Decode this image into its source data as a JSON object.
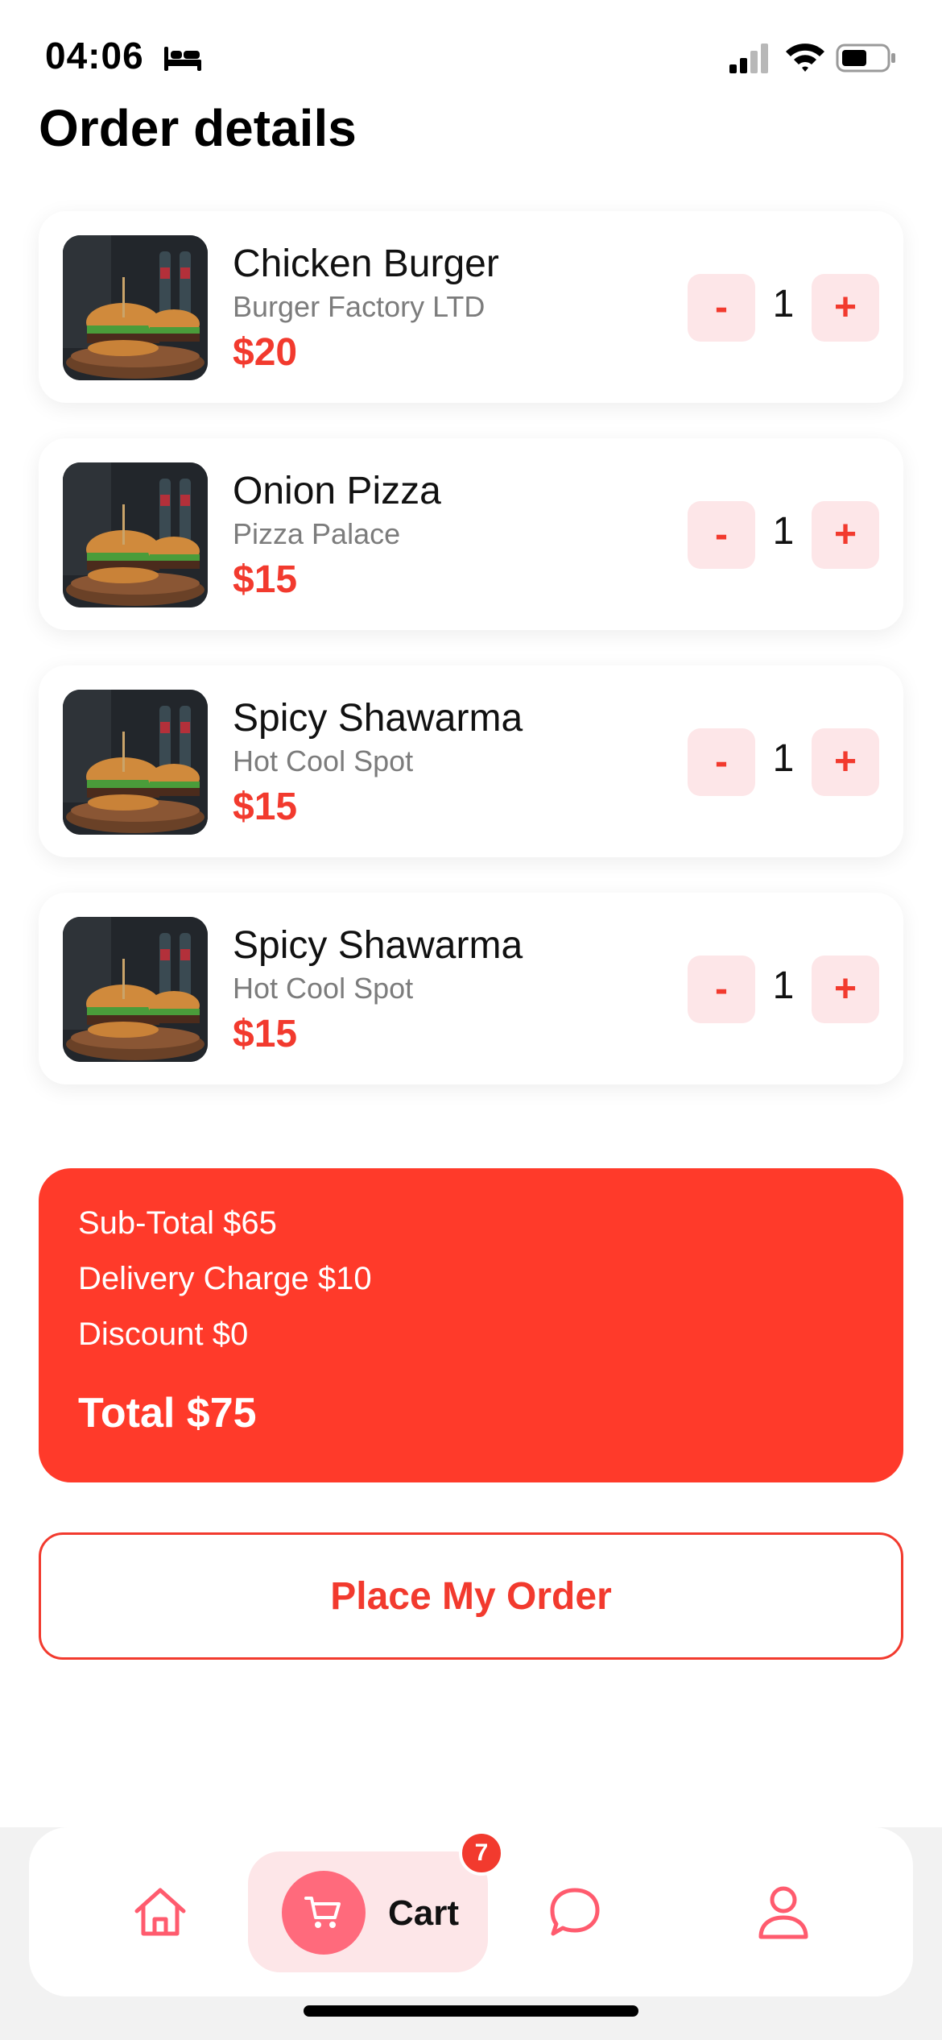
{
  "status_bar": {
    "time": "04:06"
  },
  "page": {
    "title": "Order details"
  },
  "orders": [
    {
      "name": "Chicken Burger",
      "shop": "Burger Factory LTD",
      "price": "$20",
      "quantity": "1",
      "minus_label": "-",
      "plus_label": "+"
    },
    {
      "name": "Onion Pizza",
      "shop": "Pizza Palace",
      "price": "$15",
      "quantity": "1",
      "minus_label": "-",
      "plus_label": "+"
    },
    {
      "name": "Spicy Shawarma",
      "shop": "Hot Cool Spot",
      "price": "$15",
      "quantity": "1",
      "minus_label": "-",
      "plus_label": "+"
    },
    {
      "name": "Spicy Shawarma",
      "shop": "Hot Cool Spot",
      "price": "$15",
      "quantity": "1",
      "minus_label": "-",
      "plus_label": "+"
    }
  ],
  "summary": {
    "subtotal": "Sub-Total $65",
    "delivery": "Delivery Charge $10",
    "discount": "Discount $0",
    "total": "Total $75"
  },
  "actions": {
    "place_order_label": "Place My Order"
  },
  "nav": {
    "cart_label": "Cart",
    "cart_badge": "7",
    "items": [
      "home-icon",
      "cart-icon",
      "chat-icon",
      "profile-icon"
    ]
  },
  "colors": {
    "accent": "#f23a2e",
    "summary_bg": "#ff3a2a",
    "qty_button_bg": "#fde6e8",
    "cart_circle": "#ff6a7c"
  }
}
